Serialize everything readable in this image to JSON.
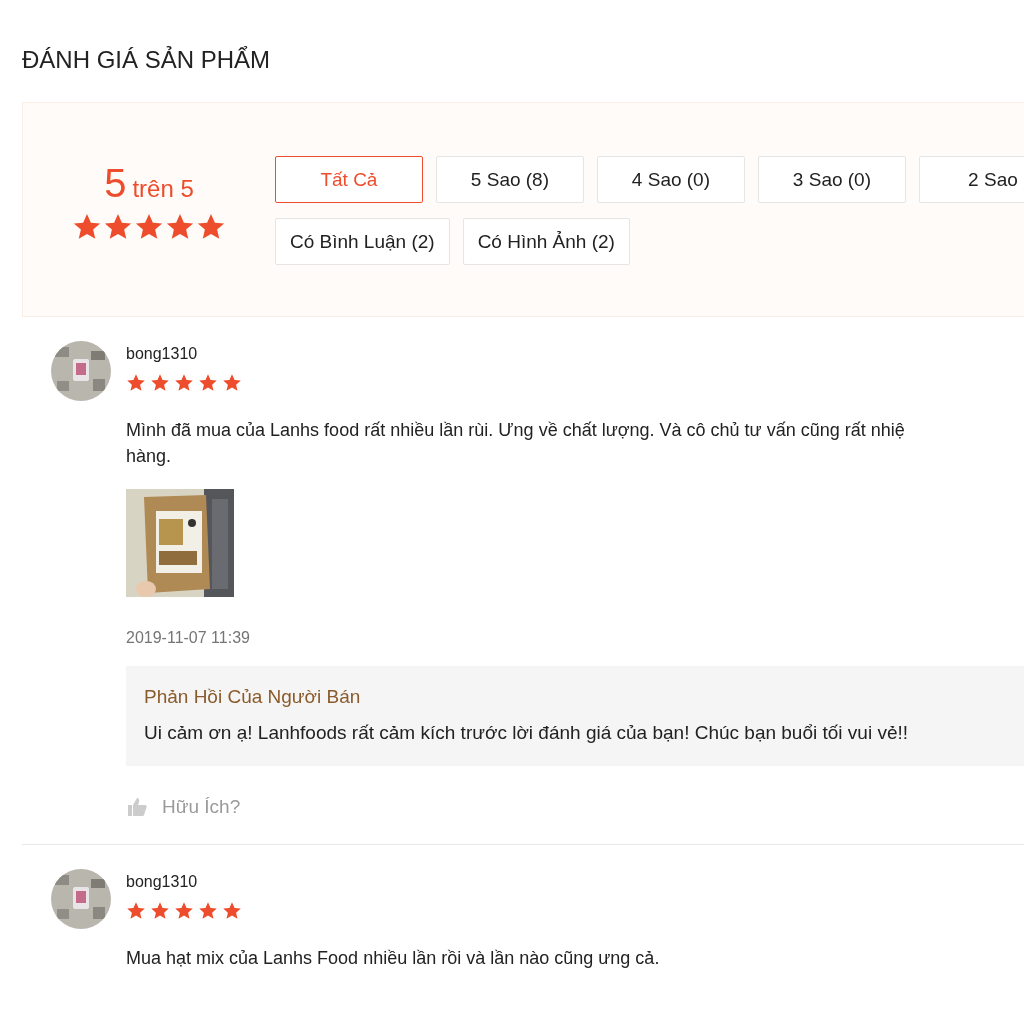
{
  "title": "ĐÁNH GIÁ SẢN PHẨM",
  "summary": {
    "score": "5",
    "score_suffix": "trên 5",
    "stars": 5
  },
  "filters": [
    {
      "label": "Tất Cả",
      "selected": true
    },
    {
      "label": "5 Sao (8)",
      "selected": false
    },
    {
      "label": "4 Sao (0)",
      "selected": false
    },
    {
      "label": "3 Sao (0)",
      "selected": false
    },
    {
      "label": "2 Sao",
      "selected": false
    },
    {
      "label": "Có Bình Luận (2)",
      "selected": false
    },
    {
      "label": "Có Hình Ảnh (2)",
      "selected": false
    }
  ],
  "reviews": [
    {
      "username": "bong1310",
      "stars": 5,
      "comment": "Mình đã mua của Lanhs food rất nhiều lần rùi. Ưng về chất lượng. Và cô chủ tư vấn cũng rất nhiệ\nhàng.",
      "images": [
        {
          "kind": "picture"
        }
      ],
      "time": "2019-11-07 11:39",
      "seller_reply": {
        "title": "Phản Hồi Của Người Bán",
        "text": "Ui cảm ơn ạ! Lanhfoods rất cảm kích trước lời đánh giá của bạn! Chúc bạn buổi tối vui vẻ!!"
      },
      "helpful": "Hữu Ích?"
    },
    {
      "username": "bong1310",
      "stars": 5,
      "comment": "Mua hạt mix của Lanhs Food nhiều lần rồi và lần nào cũng ưng cả."
    }
  ]
}
